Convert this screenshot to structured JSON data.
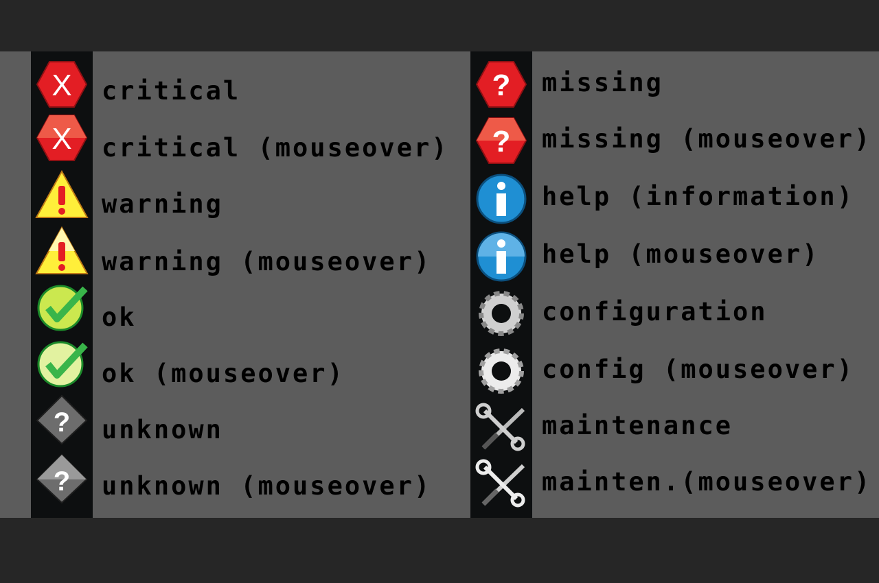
{
  "left_column": [
    {
      "label": "critical",
      "icon": "critical-icon"
    },
    {
      "label": "critical (mouseover)",
      "icon": "critical-hover-icon"
    },
    {
      "label": "warning",
      "icon": "warning-icon"
    },
    {
      "label": "warning (mouseover)",
      "icon": "warning-hover-icon"
    },
    {
      "label": "ok",
      "icon": "ok-icon"
    },
    {
      "label": "ok (mouseover)",
      "icon": "ok-hover-icon"
    },
    {
      "label": "unknown",
      "icon": "unknown-icon"
    },
    {
      "label": "unknown (mouseover)",
      "icon": "unknown-hover-icon"
    }
  ],
  "right_column": [
    {
      "label": "missing",
      "icon": "missing-icon"
    },
    {
      "label": "missing (mouseover)",
      "icon": "missing-hover-icon"
    },
    {
      "label": "help (information)",
      "icon": "help-icon"
    },
    {
      "label": "help (mouseover)",
      "icon": "help-hover-icon"
    },
    {
      "label": "configuration",
      "icon": "gear-icon"
    },
    {
      "label": "config (mouseover)",
      "icon": "gear-hover-icon"
    },
    {
      "label": "maintenance",
      "icon": "wrench-icon"
    },
    {
      "label": "mainten.(mouseover)",
      "icon": "wrench-hover-icon"
    }
  ],
  "colors": {
    "background": "#262626",
    "panel": "#5c5c5c",
    "icon_strip": "#0d0f10",
    "critical_red": "#e31e24",
    "critical_red_hover": "#ee5a48",
    "warning_yellow": "#ffef3a",
    "ok_green": "#39b54a",
    "info_blue": "#1f8fd3",
    "unknown_gray": "#6d6d6d",
    "gear_gray": "#d4d4d4"
  }
}
